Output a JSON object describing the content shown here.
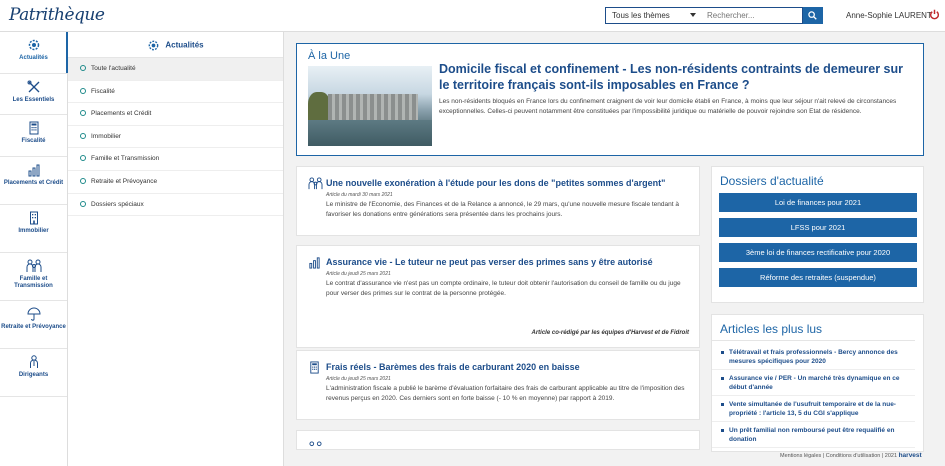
{
  "header": {
    "logo": "Patrithèque",
    "theme_select": "Tous les thèmes",
    "search_placeholder": "Rechercher...",
    "user_name": "Anne-Sophie LAURENT"
  },
  "sidebar": {
    "items": [
      {
        "label": "Actualités",
        "icon": "gear-icon"
      },
      {
        "label": "Les Essentiels",
        "icon": "tools-icon"
      },
      {
        "label": "Fiscalité",
        "icon": "calculator-icon"
      },
      {
        "label": "Placements et Crédit",
        "icon": "chart-icon"
      },
      {
        "label": "Immobilier",
        "icon": "building-icon"
      },
      {
        "label": "Famille et Transmission",
        "icon": "family-icon"
      },
      {
        "label": "Retraite et Prévoyance",
        "icon": "umbrella-icon"
      },
      {
        "label": "Dirigeants",
        "icon": "person-icon"
      }
    ]
  },
  "submenu": {
    "title": "Actualités",
    "items": [
      "Toute l'actualité",
      "Fiscalité",
      "Placements et Crédit",
      "Immobilier",
      "Famille et Transmission",
      "Retraite et Prévoyance",
      "Dossiers spéciaux"
    ]
  },
  "une": {
    "label": "À la Une",
    "title": "Domicile fiscal et confinement - Les non-résidents contraints de demeurer sur le territoire français sont-ils imposables en France ?",
    "text": "Les non-résidents bloqués en France lors du confinement craignent de voir leur domicile établi en France, à moins que leur séjour n'ait relevé de circonstances exceptionnelles. Celles-ci peuvent notamment être constituées par l'impossibilité juridique ou matérielle de pouvoir rejoindre son Etat de résidence."
  },
  "articles": [
    {
      "title": "Une nouvelle exonération à l'étude pour les dons de \"petites sommes d'argent\"",
      "date": "Article du mardi 30 mars 2021",
      "text": "Le ministre de l'Economie, des Finances et de la Relance a annoncé, le 29 mars, qu'une nouvelle mesure fiscale tendant à favoriser les donations entre générations sera présentée dans les prochains jours.",
      "credit": ""
    },
    {
      "title": "Assurance vie - Le tuteur ne peut pas verser des primes sans y être autorisé",
      "date": "Article du jeudi 25 mars 2021",
      "text": "Le contrat d'assurance vie n'est pas un compte ordinaire, le tuteur doit obtenir l'autorisation du conseil de famille ou du juge pour verser des primes sur le contrat de la personne protégée.",
      "credit": "Article co-rédigé par les équipes d'Harvest et de Fidroit"
    },
    {
      "title": "Frais réels - Barèmes des frais de carburant 2020 en baisse",
      "date": "Article du jeudi 25 mars 2021",
      "text": "L'administration fiscale a publié le barème d'évaluation forfaitaire des frais de carburant applicable au titre de l'imposition des revenus perçus en 2020. Ces derniers sont en forte baisse (- 10 % en moyenne) par rapport à 2019.",
      "credit": ""
    }
  ],
  "dossiers": {
    "title": "Dossiers d'actualité",
    "items": [
      "Loi de finances pour 2021",
      "LFSS pour 2021",
      "3ème loi de finances rectificative pour 2020",
      "Réforme des retraites (suspendue)"
    ]
  },
  "plus_lus": {
    "title": "Articles les plus lus",
    "items": [
      "Télétravail et frais professionnels - Bercy annonce des mesures spécifiques pour 2020",
      "Assurance vie / PER - Un marché très dynamique en ce début d'année",
      "Vente simultanée de l'usufruit temporaire et de la nue-propriété : l'article 13, 5 du CGI s'applique",
      "Un prêt familial non remboursé peut être requalifié en donation"
    ]
  },
  "footer": {
    "text": "Mentions légales | Conditions d'utilisation | 2021",
    "brand": "harvest"
  }
}
